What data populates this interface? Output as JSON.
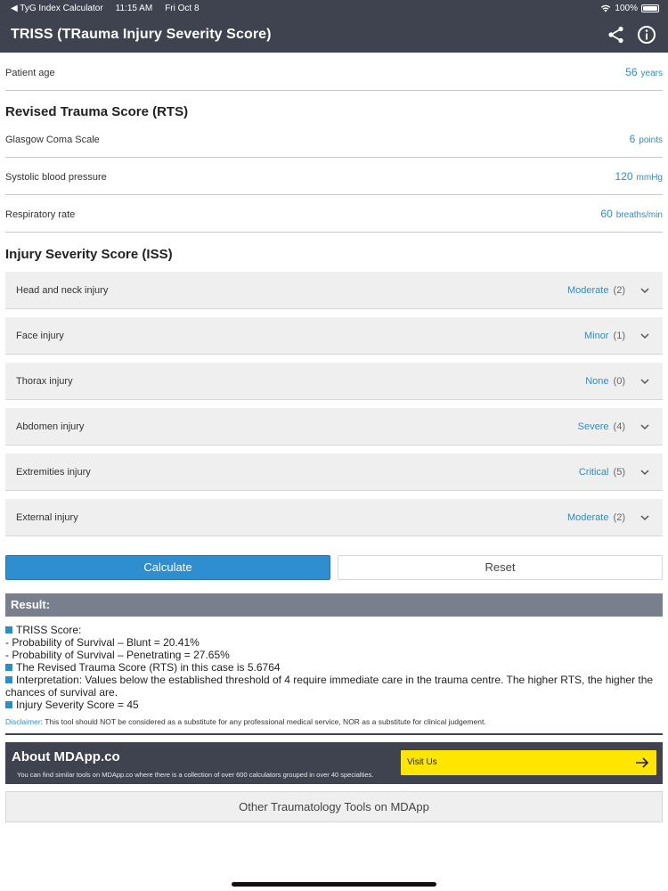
{
  "status_bar": {
    "back_app": "◀ TyG Index Calculator",
    "time": "11:15 AM",
    "date": "Fri Oct 8",
    "battery": "100%"
  },
  "header": {
    "title": "TRISS (TRauma Injury Severity Score)"
  },
  "patient_age": {
    "label": "Patient age",
    "value": "56",
    "unit": "years"
  },
  "rts": {
    "title": "Revised Trauma Score (RTS)",
    "fields": [
      {
        "label": "Glasgow Coma Scale",
        "value": "6",
        "unit": "points"
      },
      {
        "label": "Systolic blood pressure",
        "value": "120",
        "unit": "mmHg"
      },
      {
        "label": "Respiratory rate",
        "value": "60",
        "unit": "breaths/min"
      }
    ]
  },
  "iss": {
    "title": "Injury Severity Score (ISS)",
    "fields": [
      {
        "label": "Head and neck injury",
        "value": "Moderate",
        "points": "(2)"
      },
      {
        "label": "Face injury",
        "value": "Minor",
        "points": "(1)"
      },
      {
        "label": "Thorax injury",
        "value": "None",
        "points": "(0)"
      },
      {
        "label": "Abdomen injury",
        "value": "Severe",
        "points": "(4)"
      },
      {
        "label": "Extremities injury",
        "value": "Critical",
        "points": "(5)"
      },
      {
        "label": "External injury",
        "value": "Moderate",
        "points": "(2)"
      }
    ]
  },
  "buttons": {
    "calculate": "Calculate",
    "reset": "Reset"
  },
  "result": {
    "header": "Result:",
    "triss_title": "TRISS Score:",
    "blunt": " - Probability of Survival – Blunt = 20.41%",
    "penetrating": " - Probability of Survival – Penetrating = 27.65%",
    "rts": "The Revised Trauma Score (RTS) in this case is 5.6764",
    "interpretation": "Interpretation: Values below the established threshold of 4 require immediate care in the trauma centre. The higher RTS, the higher the chances of survival are.",
    "iss": "Injury Severity Score = 45"
  },
  "disclaimer": {
    "label": "Disclaimer",
    "text": ": This tool should NOT be considered as a substitute for any professional medical service, NOR as a substitute for clinical judgement."
  },
  "about": {
    "title": "About MDApp.co",
    "description": "You can find similar tools on MDApp.co where there is a collection of over 600 calculators grouped in over 40 specialties.",
    "visit_label": "Visit Us"
  },
  "other_tools": "Other Traumatology Tools on MDApp",
  "colors": {
    "header_bg": "#3f4350",
    "accent": "#2b8fc5",
    "calculate_bg": "#2e8ecf",
    "result_bar": "#7a7f8e",
    "visit_bg": "#ffe600"
  }
}
